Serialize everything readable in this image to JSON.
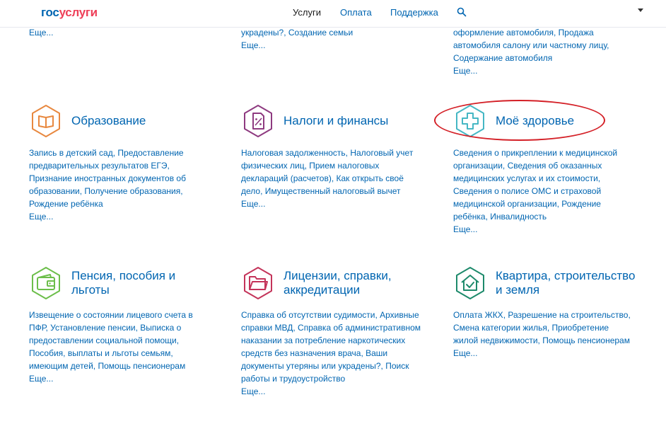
{
  "header": {
    "logo_gos": "гос",
    "logo_uslugi": "услуги",
    "nav": [
      "Услуги",
      "Оплата",
      "Поддержка"
    ]
  },
  "top_partial": {
    "col1_more": "Еще...",
    "col2_links": "украдены?, Создание семьи",
    "col2_more": "Еще...",
    "col3_links": "оформление автомобиля, Продажа автомобиля салону или частному лицу, Содержание автомобиля",
    "col3_more": "Еще..."
  },
  "categories": [
    {
      "title": "Образование",
      "icon": "book-icon",
      "color": "#e8883f",
      "links": "Запись в детский сад, Предоставление предварительных результатов ЕГЭ, Признание иностранных документов об образовании, Получение образования, Рождение ребёнка",
      "more": "Еще..."
    },
    {
      "title": "Налоги и финансы",
      "icon": "tax-document-icon",
      "color": "#8e3a80",
      "links": "Налоговая задолженность, Налоговый учет физических лиц, Прием налоговых деклараций (расчетов), Как открыть своё дело, Имущественный налоговый вычет",
      "more": "Еще..."
    },
    {
      "title": "Моё здоровье",
      "icon": "medical-cross-icon",
      "color": "#45b7c4",
      "links": "Сведения о прикреплении к медицинской организации, Сведения об оказанных медицинских услугах и их стоимости, Сведения о полисе ОМС и страховой медицинской организации, Рождение ребёнка, Инвалидность",
      "more": "Еще..."
    },
    {
      "title": "Пенсия, пособия и льготы",
      "icon": "wallet-icon",
      "color": "#6cbe4a",
      "links": "Извещение о состоянии лицевого счета в ПФР, Установление пенсии, Выписка о предоставлении социальной помощи, Пособия, выплаты и льготы семьям, имеющим детей, Помощь пенсионерам",
      "more": "Еще..."
    },
    {
      "title": "Лицензии, справки, аккредитации",
      "icon": "folder-icon",
      "color": "#c4345a",
      "links": "Справка об отсутствии судимости, Архивные справки МВД, Справка об административном наказании за потребление наркотических средств без назначения врача, Ваши документы утеряны или украдены?, Поиск работы и трудоустройство",
      "more": "Еще..."
    },
    {
      "title": "Квартира, строительство и земля",
      "icon": "house-check-icon",
      "color": "#1d8a6b",
      "links": "Оплата ЖКХ, Разрешение на строительство, Смена категории жилья, Приобретение жилой недвижимости, Помощь пенсионерам",
      "more": "Еще..."
    }
  ]
}
